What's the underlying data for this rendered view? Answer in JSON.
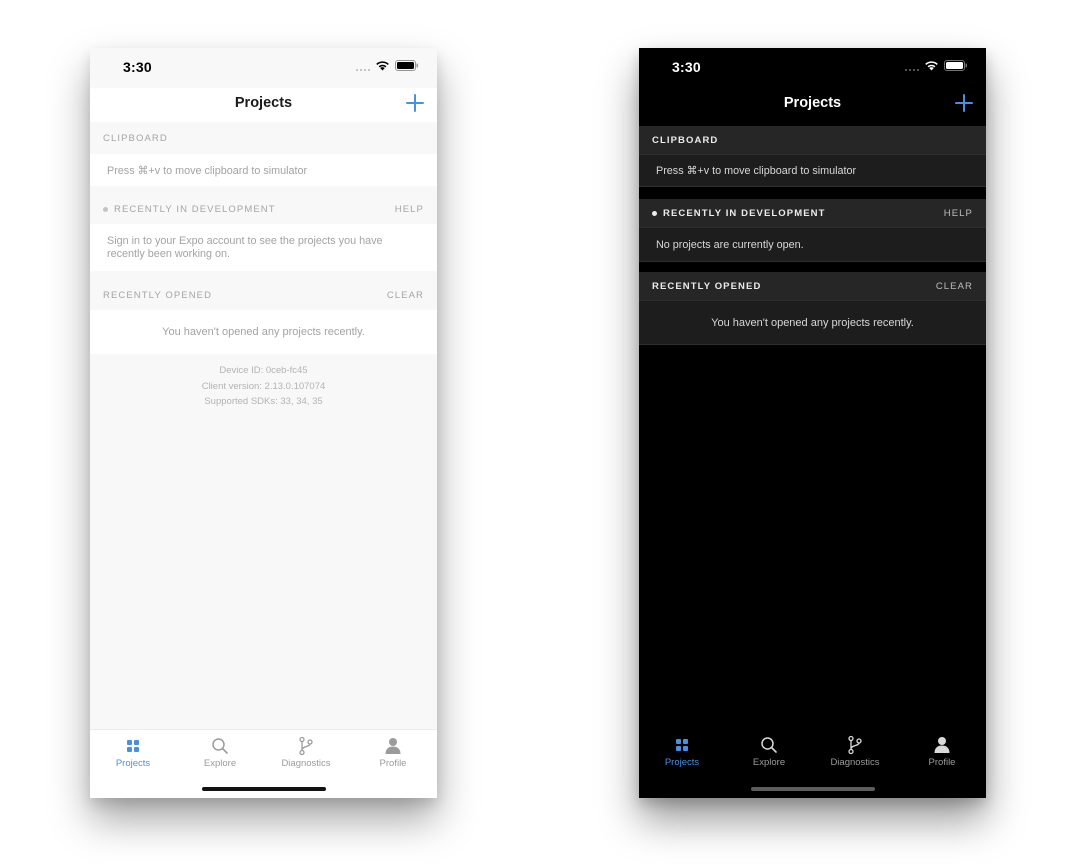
{
  "colors": {
    "accent": "#4a90e2",
    "light_background": "#f8f8f8",
    "dark_background": "#000000",
    "dark_row": "#1d1d1d",
    "dark_header": "#262626"
  },
  "light": {
    "status": {
      "time": "3:30"
    },
    "nav": {
      "title": "Projects",
      "add_icon": "plus-icon"
    },
    "clipboard": {
      "header": "CLIPBOARD",
      "text": "Press ⌘+v to move clipboard to simulator"
    },
    "recent_dev": {
      "header": "RECENTLY IN DEVELOPMENT",
      "action": "HELP",
      "text": "Sign in to your Expo account to see the projects you have recently been working on."
    },
    "recent_opened": {
      "header": "RECENTLY OPENED",
      "action": "CLEAR",
      "empty_text": "You haven't opened any projects recently."
    },
    "device_info": {
      "device_id": "Device ID: 0ceb-fc45",
      "client_version": "Client version: 2.13.0.107074",
      "sdks": "Supported SDKs: 33, 34, 35"
    },
    "tabs": [
      {
        "label": "Projects",
        "icon": "grid-icon",
        "active": true
      },
      {
        "label": "Explore",
        "icon": "search-icon",
        "active": false
      },
      {
        "label": "Diagnostics",
        "icon": "branch-icon",
        "active": false
      },
      {
        "label": "Profile",
        "icon": "person-icon",
        "active": false
      }
    ]
  },
  "dark": {
    "status": {
      "time": "3:30"
    },
    "nav": {
      "title": "Projects",
      "add_icon": "plus-icon"
    },
    "clipboard": {
      "header": "CLIPBOARD",
      "text": "Press ⌘+v to move clipboard to simulator"
    },
    "recent_dev": {
      "header": "RECENTLY IN DEVELOPMENT",
      "action": "HELP",
      "text": "No projects are currently open."
    },
    "recent_opened": {
      "header": "RECENTLY OPENED",
      "action": "CLEAR",
      "empty_text": "You haven't opened any projects recently."
    },
    "tabs": [
      {
        "label": "Projects",
        "icon": "grid-icon",
        "active": true
      },
      {
        "label": "Explore",
        "icon": "search-icon",
        "active": false
      },
      {
        "label": "Diagnostics",
        "icon": "branch-icon",
        "active": false
      },
      {
        "label": "Profile",
        "icon": "person-icon",
        "active": false
      }
    ]
  }
}
